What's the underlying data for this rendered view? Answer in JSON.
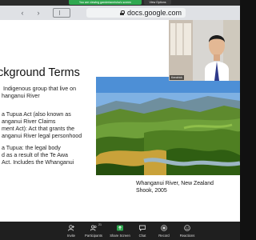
{
  "meeting": {
    "recording_banner": "You are viewing gandertaneisha's screen",
    "view_options": "View Options"
  },
  "browser": {
    "url": "docs.google.com",
    "back_glyph": "‹",
    "forward_glyph": "›"
  },
  "slide": {
    "title": "ckground Terms",
    "bullets": [
      " Indigenous group that live on\nhanganui River",
      "a Tupua Act (also known as\nanganui River Claims\nment Act): Act that grants the\nanganui River legal personhood",
      "a Tupua: the legal body\nd as a result of the Te Awa\nAct. Includes the Whanganui"
    ],
    "photo_caption": "Whanganui River, New Zealand\nShook, 2005"
  },
  "video": {
    "participant_name": "Kendrick"
  },
  "controls": {
    "items": [
      {
        "label": "Invite"
      },
      {
        "label": "Participants"
      },
      {
        "label": "Share Screen"
      },
      {
        "label": "Chat"
      },
      {
        "label": "Record"
      },
      {
        "label": "Reactions"
      }
    ],
    "participants_count": "21",
    "accent_share": "#2fa84f",
    "accent_record": "#e04040"
  }
}
